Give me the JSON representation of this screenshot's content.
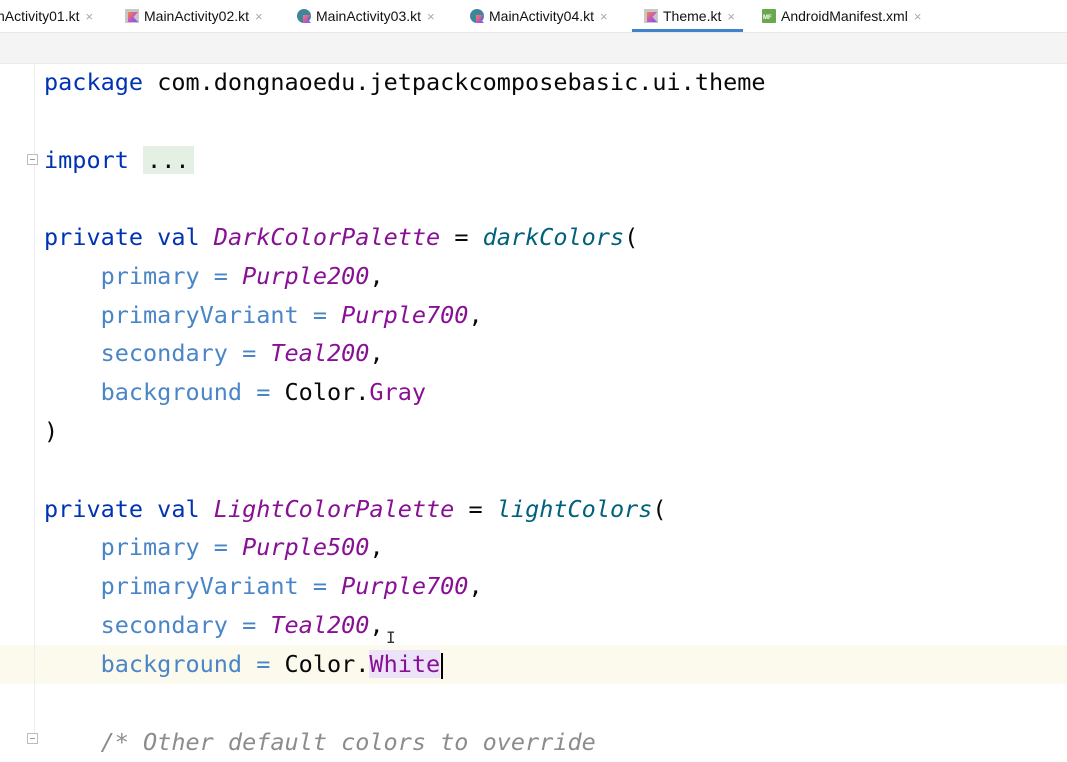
{
  "tabs": [
    {
      "label": "nActivity01.kt",
      "icon": "kotlin-file-icon",
      "active": false
    },
    {
      "label": "MainActivity02.kt",
      "icon": "kotlin-file-icon",
      "active": false
    },
    {
      "label": "MainActivity03.kt",
      "icon": "kotlin-class-icon",
      "active": false
    },
    {
      "label": "MainActivity04.kt",
      "icon": "kotlin-class-icon",
      "active": false
    },
    {
      "label": "Theme.kt",
      "icon": "kotlin-file-icon",
      "active": true
    },
    {
      "label": "AndroidManifest.xml",
      "icon": "manifest-file-icon",
      "active": false
    }
  ],
  "tab_close": "×",
  "colors": {
    "accent": "#4083c9",
    "keyword": "#0033b3",
    "property": "#871094",
    "function": "#00627a",
    "param": "#4a86c7"
  },
  "code": {
    "l1": {
      "kw": "package",
      "rest": " com.dongnaoedu.jetpackcomposebasic.ui.theme"
    },
    "l2": {
      "kw": "import",
      "fold": "..."
    },
    "l3": {
      "kw": "private val",
      "name": "DarkColorPalette",
      "eq": " = ",
      "fn": "darkColors",
      "paren": "("
    },
    "l4": {
      "param": "primary",
      "eq": " = ",
      "val": "Purple200",
      "end": ","
    },
    "l5": {
      "param": "primaryVariant",
      "eq": " = ",
      "val": "Purple700",
      "end": ","
    },
    "l6": {
      "param": "secondary",
      "eq": " = ",
      "val": "Teal200",
      "end": ","
    },
    "l7": {
      "param": "background",
      "eq": " = ",
      "obj": "Color.",
      "val": "Gray"
    },
    "l8": {
      "text": ")"
    },
    "l9": {
      "kw": "private val",
      "name": "LightColorPalette",
      "eq": " = ",
      "fn": "lightColors",
      "paren": "("
    },
    "l10": {
      "param": "primary",
      "eq": " = ",
      "val": "Purple500",
      "end": ","
    },
    "l11": {
      "param": "primaryVariant",
      "eq": " = ",
      "val": "Purple700",
      "end": ","
    },
    "l12": {
      "param": "secondary",
      "eq": " = ",
      "val": "Teal200",
      "end": ","
    },
    "l13": {
      "param": "background",
      "eq": " = ",
      "obj": "Color.",
      "val": "White"
    },
    "l14": {
      "comment": "/* Other default colors to override"
    }
  }
}
